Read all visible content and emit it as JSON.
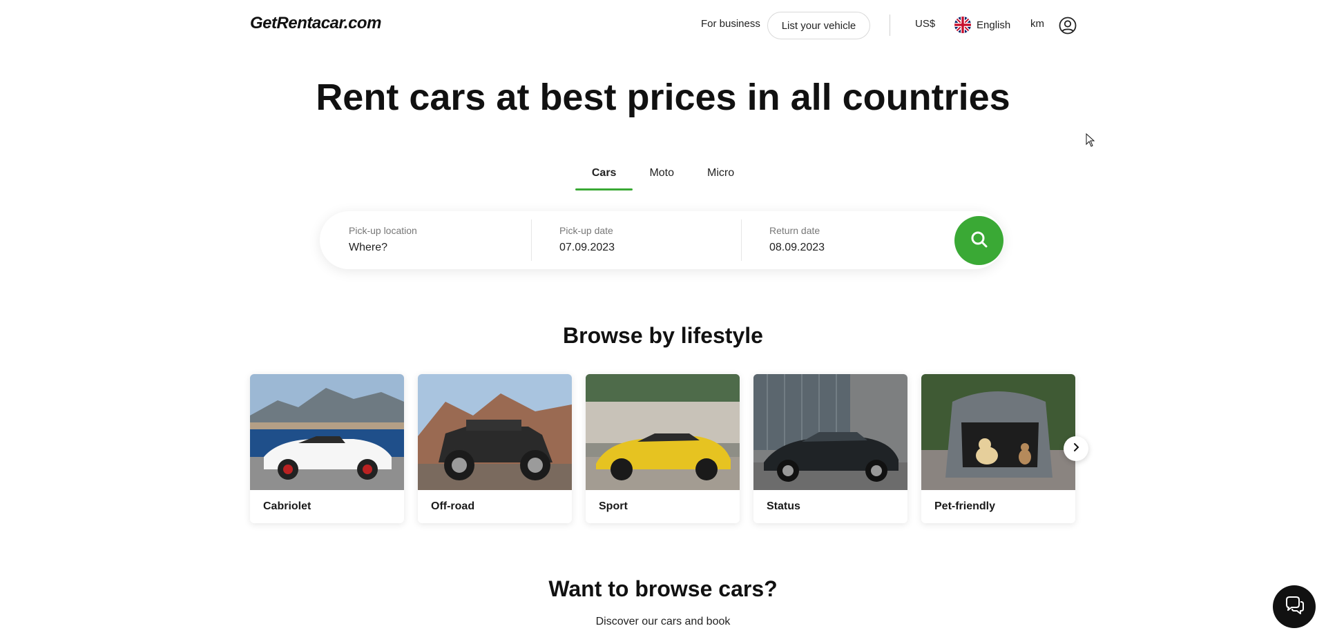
{
  "header": {
    "logo": "GetRentacar.com",
    "for_business": "For business",
    "list_vehicle": "List your vehicle",
    "currency": "US$",
    "language": "English",
    "units": "km",
    "flag_icon": "uk-flag-icon",
    "account_icon": "user-circle-icon"
  },
  "hero": {
    "title": "Rent cars at best prices in all countries",
    "tabs": [
      {
        "label": "Cars",
        "active": true
      },
      {
        "label": "Moto",
        "active": false
      },
      {
        "label": "Micro",
        "active": false
      }
    ]
  },
  "search": {
    "pickup_location": {
      "label": "Pick-up location",
      "placeholder": "Where?"
    },
    "pickup_date": {
      "label": "Pick-up date",
      "value": "07.09.2023"
    },
    "return_date": {
      "label": "Return date",
      "value": "08.09.2023"
    },
    "button_icon": "search-icon"
  },
  "lifestyle": {
    "title": "Browse by lifestyle",
    "cards": [
      {
        "name": "Cabriolet"
      },
      {
        "name": "Off-road"
      },
      {
        "name": "Sport"
      },
      {
        "name": "Status"
      },
      {
        "name": "Pet-friendly"
      }
    ]
  },
  "browse": {
    "title": "Want to browse cars?",
    "subtitle": "Discover our cars and book"
  },
  "colors": {
    "accent": "#3aa935",
    "chat_bg": "#111111"
  },
  "chat_icon": "chat-support-icon"
}
